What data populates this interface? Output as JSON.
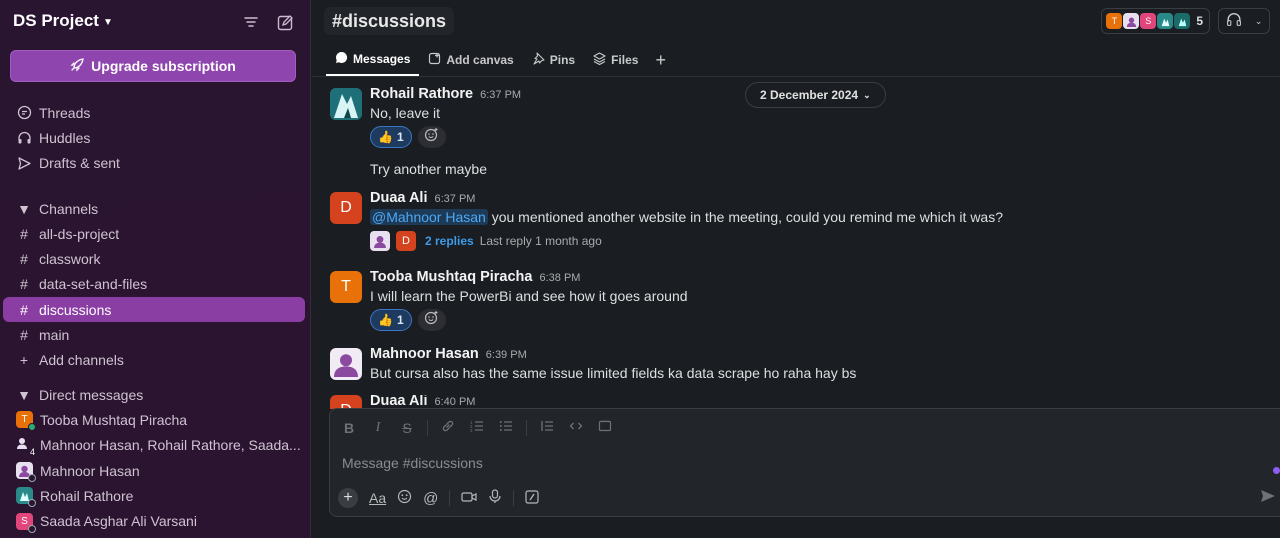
{
  "workspace": {
    "name": "DS Project"
  },
  "sidebar": {
    "upgrade_label": "Upgrade subscription",
    "top_items": [
      {
        "label": "Threads",
        "icon": "threads-icon"
      },
      {
        "label": "Huddles",
        "icon": "headphones-icon"
      },
      {
        "label": "Drafts & sent",
        "icon": "send-icon"
      }
    ],
    "channels_header": "Channels",
    "channels": [
      "all-ds-project",
      "classwork",
      "data-set-and-files",
      "discussions",
      "main"
    ],
    "active_channel": "discussions",
    "add_channels": "Add channels",
    "dms_header": "Direct messages",
    "dms": [
      {
        "label": "Tooba Mushtaq Piracha",
        "initial": "T",
        "color": "#e8710a"
      },
      {
        "label": "Mahnoor Hasan, Rohail Rathore, Saada...",
        "initial": "4",
        "color": "#3c3c3c"
      },
      {
        "label": "Mahnoor Hasan",
        "initial": "",
        "color": "#e8e0f0"
      },
      {
        "label": "Rohail Rathore",
        "initial": "",
        "color": "#2a8a8a"
      },
      {
        "label": "Saada Asghar Ali Varsani",
        "initial": "S",
        "color": "#e0457b"
      }
    ]
  },
  "header": {
    "channel": "#discussions",
    "member_count": "5",
    "tabs": [
      {
        "label": "Messages",
        "icon": "message-icon"
      },
      {
        "label": "Add canvas",
        "icon": "canvas-icon"
      },
      {
        "label": "Pins",
        "icon": "pin-icon"
      },
      {
        "label": "Files",
        "icon": "files-icon"
      }
    ],
    "members": [
      {
        "initial": "T",
        "color": "#e8710a"
      },
      {
        "initial": "",
        "color": "#e8e0f0"
      },
      {
        "initial": "S",
        "color": "#e0457b"
      },
      {
        "initial": "",
        "color": "#2a8a8a"
      },
      {
        "initial": "",
        "color": "#1a6a6a"
      }
    ]
  },
  "date_divider": "2 December 2024",
  "messages": [
    {
      "name": "Rohail Rathore",
      "time": "6:37 PM",
      "text": "No, leave it",
      "reaction": "👍",
      "reaction_count": "1"
    },
    {
      "text": "Try another maybe"
    },
    {
      "name": "Duaa Ali",
      "time": "6:37 PM",
      "mention": "@Mahnoor Hasan",
      "text": " you mentioned another website in the meeting, could you remind me which it was?",
      "replies": "2 replies",
      "last_reply": "Last reply 1 month ago"
    },
    {
      "name": "Tooba Mushtaq Piracha",
      "time": "6:38 PM",
      "text": "I will learn the PowerBi and see how it goes around",
      "reaction": "👍",
      "reaction_count": "1"
    },
    {
      "name": "Mahnoor Hasan",
      "time": "6:39 PM",
      "text": "But cursa also has the same issue limited fields ka data scrape ho raha hay bs"
    },
    {
      "name": "Duaa Ali",
      "time": "6:40 PM"
    }
  ],
  "avatars": {
    "duaa": {
      "initial": "D",
      "color": "#d4421e"
    },
    "tooba": {
      "initial": "T",
      "color": "#e8710a"
    }
  },
  "composer": {
    "placeholder": "Message #discussions"
  }
}
